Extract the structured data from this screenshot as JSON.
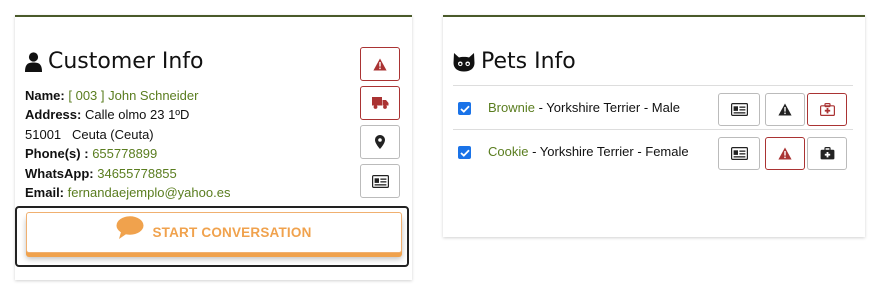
{
  "customer": {
    "title": "Customer Info",
    "name_label": "Name:",
    "name_value": "[ 003 ] John Schneider",
    "address_label": "Address:",
    "address_value": "Calle olmo 23 1ºD",
    "city_line": "51001   Ceuta (Ceuta)",
    "phones_label": "Phone(s) :",
    "phones_value": "655778899",
    "whatsapp_label": "WhatsApp:",
    "whatsapp_value": "34655778855",
    "email_label": "Email:",
    "email_value": "fernandaejemplo@yahoo.es",
    "conversation_label": "START CONVERSATION"
  },
  "pets": {
    "title": "Pets Info",
    "rows": [
      {
        "name": "Brownie",
        "details": " - Yorkshire Terrier - Male",
        "checked": true
      },
      {
        "name": "Cookie",
        "details": " - Yorkshire Terrier - Female",
        "checked": true
      }
    ]
  },
  "icons": {
    "customer_buttons": [
      "warning-icon",
      "truck-icon",
      "map-marker-icon",
      "id-card-icon"
    ],
    "pet_buttons": [
      "id-card-icon",
      "warning-icon",
      "medkit-icon"
    ]
  },
  "colors": {
    "accent_green": "#5a7d1f",
    "alert_red": "#a33333",
    "conversation_orange": "#f0a24d",
    "card_top_border": "#4a5a2a"
  }
}
